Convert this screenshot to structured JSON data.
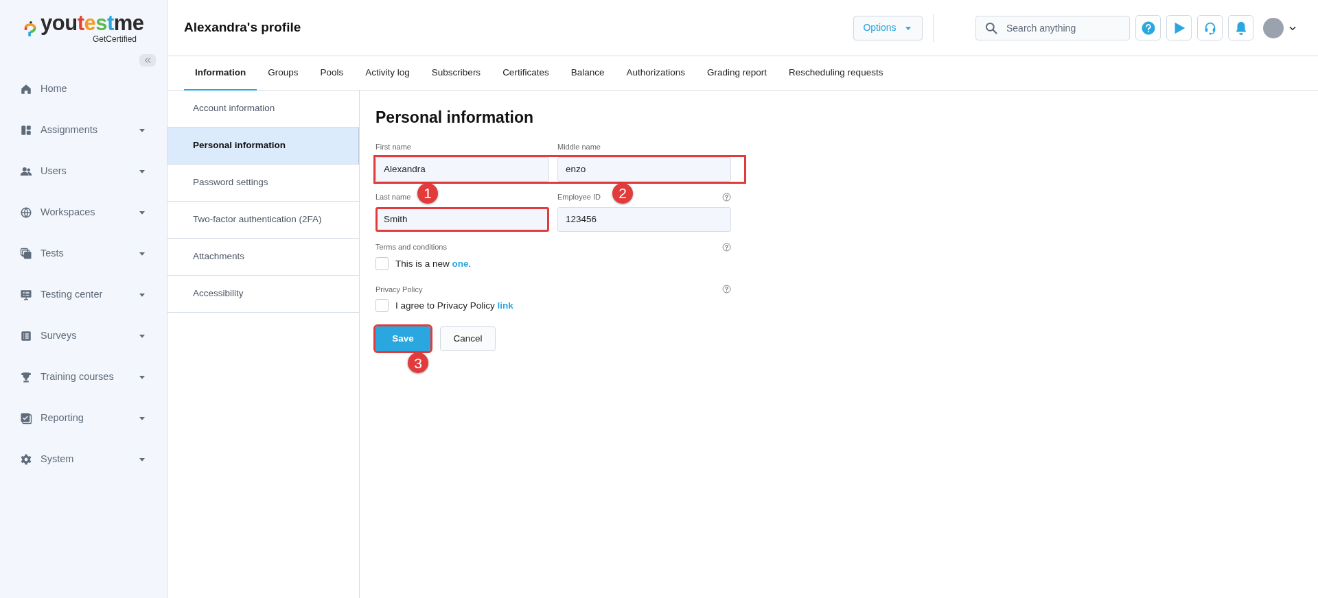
{
  "logo": {
    "parts": [
      {
        "text": "you",
        "color": "#2b2b2b"
      },
      {
        "text": "t",
        "color": "#e2452f"
      },
      {
        "text": "e",
        "color": "#f59b23"
      },
      {
        "text": "s",
        "color": "#5bb94a"
      },
      {
        "text": "t",
        "color": "#2aa7df"
      },
      {
        "text": "me",
        "color": "#2b2b2b"
      }
    ],
    "tagline": "GetCertified"
  },
  "sidebar": {
    "items": [
      {
        "label": "Home",
        "has_submenu": false
      },
      {
        "label": "Assignments",
        "has_submenu": true
      },
      {
        "label": "Users",
        "has_submenu": true
      },
      {
        "label": "Workspaces",
        "has_submenu": true
      },
      {
        "label": "Tests",
        "has_submenu": true
      },
      {
        "label": "Testing center",
        "has_submenu": true
      },
      {
        "label": "Surveys",
        "has_submenu": true
      },
      {
        "label": "Training courses",
        "has_submenu": true
      },
      {
        "label": "Reporting",
        "has_submenu": true
      },
      {
        "label": "System",
        "has_submenu": true
      }
    ]
  },
  "header": {
    "title": "Alexandra's profile",
    "options_button": "Options",
    "search": {
      "placeholder": "Search anything"
    }
  },
  "tabs": [
    {
      "label": "Information",
      "selected": true
    },
    {
      "label": "Groups",
      "selected": false
    },
    {
      "label": "Pools",
      "selected": false
    },
    {
      "label": "Activity log",
      "selected": false
    },
    {
      "label": "Subscribers",
      "selected": false
    },
    {
      "label": "Certificates",
      "selected": false
    },
    {
      "label": "Balance",
      "selected": false
    },
    {
      "label": "Authorizations",
      "selected": false
    },
    {
      "label": "Grading report",
      "selected": false
    },
    {
      "label": "Rescheduling requests",
      "selected": false
    }
  ],
  "submenu": [
    {
      "label": "Account information",
      "selected": false
    },
    {
      "label": "Personal information",
      "selected": true
    },
    {
      "label": "Password settings",
      "selected": false
    },
    {
      "label": "Two-factor authentication (2FA)",
      "selected": false
    },
    {
      "label": "Attachments",
      "selected": false
    },
    {
      "label": "Accessibility",
      "selected": false
    }
  ],
  "form": {
    "title": "Personal information",
    "rows": [
      {
        "highlighted": true,
        "fields": [
          {
            "label": "First name",
            "value": "Alexandra"
          },
          {
            "label": "Middle name",
            "value": "enzo"
          }
        ]
      },
      {
        "fields": [
          {
            "label": "Last name",
            "value": "Smith",
            "highlighted": true,
            "marker": "1"
          },
          {
            "label": "Employee ID",
            "value": "123456",
            "help": true,
            "marker": "2"
          }
        ]
      }
    ],
    "checkboxes": [
      {
        "label": "Terms and conditions",
        "text": "This is a new ",
        "link": "one",
        "text_after": ".",
        "checked": false,
        "help": true
      },
      {
        "label": "Privacy Policy",
        "text": "I agree to Privacy Policy ",
        "link": "link",
        "checked": false,
        "help": true
      }
    ],
    "save_button": {
      "label": "Save",
      "highlighted": true,
      "marker": "3"
    },
    "cancel_button": {
      "label": "Cancel"
    }
  }
}
